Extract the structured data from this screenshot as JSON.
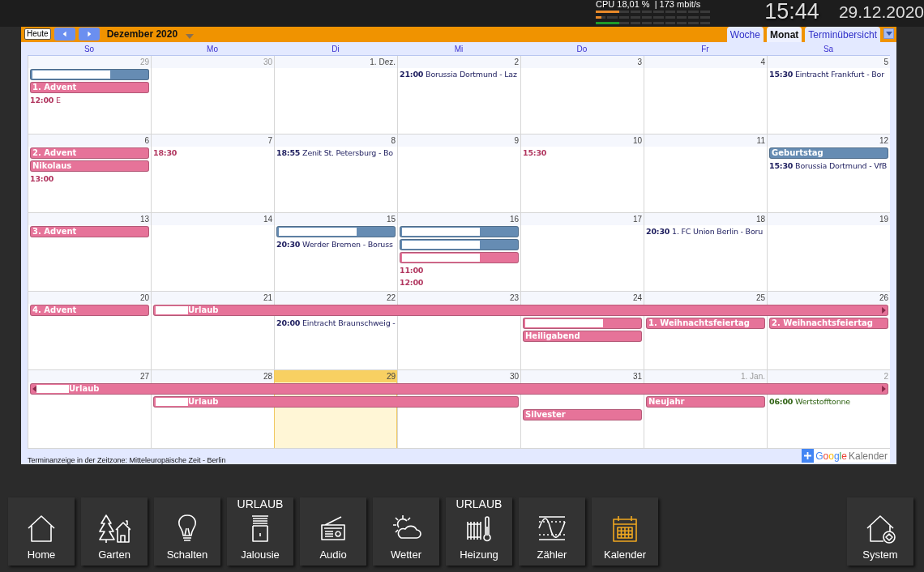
{
  "status": {
    "cpu": "CPU 18,01 %",
    "network": "| 173 mbit/s",
    "meters": [
      {
        "color": "#e8892a",
        "level": 0.2
      },
      {
        "color": "#e8892a",
        "level": 0.05
      },
      {
        "color": "#1f9a2a",
        "level": 0.2
      }
    ],
    "time": "15:44",
    "date": "29.12.2020"
  },
  "calendar": {
    "today_button": "Heute",
    "month": "Dezember 2020",
    "tabs": [
      {
        "label": "Woche",
        "selected": false
      },
      {
        "label": "Monat",
        "selected": true
      },
      {
        "label": "Terminübersicht",
        "selected": false
      }
    ],
    "weekdays": [
      "So",
      "Mo",
      "Di",
      "Mi",
      "Do",
      "Fr",
      "Sa"
    ],
    "weeks": [
      {
        "days": [
          {
            "label": "29",
            "other_month": true,
            "today": false
          },
          {
            "label": "30",
            "other_month": true,
            "today": false
          },
          {
            "label": "1. Dez.",
            "other_month": false,
            "today": false
          },
          {
            "label": "2",
            "other_month": false,
            "today": false
          },
          {
            "label": "3",
            "other_month": false,
            "today": false
          },
          {
            "label": "4",
            "other_month": false,
            "today": false
          },
          {
            "label": "5",
            "other_month": false,
            "today": false
          }
        ],
        "lanes": [
          [
            {
              "kind": "allday",
              "color": "#668cb3",
              "redacted": true
            },
            {
              "kind": "empty"
            },
            {
              "kind": "empty"
            },
            {
              "kind": "timed",
              "color": "#1d1d5e",
              "time": "21:00",
              "title": "Borussia Dortmund - Laz"
            },
            {
              "kind": "empty"
            },
            {
              "kind": "empty"
            },
            {
              "kind": "timed",
              "color": "#1d1d5e",
              "time": "15:30",
              "title": "Eintracht Frankfurt - Bor"
            }
          ],
          [
            {
              "kind": "allday",
              "color": "#e67399",
              "title": "1. Advent"
            }
          ],
          [
            {
              "kind": "timed",
              "color": "#b1365f",
              "time": "12:00",
              "title": "E"
            }
          ]
        ]
      },
      {
        "days": [
          {
            "label": "6",
            "other_month": false,
            "today": false
          },
          {
            "label": "7",
            "other_month": false,
            "today": false
          },
          {
            "label": "8",
            "other_month": false,
            "today": false
          },
          {
            "label": "9",
            "other_month": false,
            "today": false
          },
          {
            "label": "10",
            "other_month": false,
            "today": false
          },
          {
            "label": "11",
            "other_month": false,
            "today": false
          },
          {
            "label": "12",
            "other_month": false,
            "today": false
          }
        ],
        "lanes": [
          [
            {
              "kind": "allday",
              "color": "#e67399",
              "title": "2. Advent"
            },
            {
              "kind": "timed",
              "color": "#b1365f",
              "time": "18:30"
            },
            {
              "kind": "timed",
              "color": "#1d1d5e",
              "time": "18:55",
              "title": "Zenit St. Petersburg - Bo"
            },
            {
              "kind": "empty"
            },
            {
              "kind": "timed",
              "color": "#b1365f",
              "time": "15:30"
            },
            {
              "kind": "empty"
            },
            {
              "kind": "allday",
              "color": "#668cb3",
              "title": "Geburtstag"
            }
          ],
          [
            {
              "kind": "allday",
              "color": "#e67399",
              "title": "Nikolaus"
            },
            {
              "kind": "empty"
            },
            {
              "kind": "empty"
            },
            {
              "kind": "empty"
            },
            {
              "kind": "empty"
            },
            {
              "kind": "empty"
            },
            {
              "kind": "timed",
              "color": "#1d1d5e",
              "time": "15:30",
              "title": "Borussia Dortmund - VfB"
            }
          ],
          [
            {
              "kind": "timed",
              "color": "#b1365f",
              "time": "13:00"
            }
          ]
        ]
      },
      {
        "days": [
          {
            "label": "13",
            "other_month": false,
            "today": false
          },
          {
            "label": "14",
            "other_month": false,
            "today": false
          },
          {
            "label": "15",
            "other_month": false,
            "today": false
          },
          {
            "label": "16",
            "other_month": false,
            "today": false
          },
          {
            "label": "17",
            "other_month": false,
            "today": false
          },
          {
            "label": "18",
            "other_month": false,
            "today": false
          },
          {
            "label": "19",
            "other_month": false,
            "today": false
          }
        ],
        "lanes": [
          [
            {
              "kind": "allday",
              "color": "#e67399",
              "title": "3. Advent"
            },
            {
              "kind": "empty"
            },
            {
              "kind": "allday",
              "color": "#668cb3",
              "redacted": true
            },
            {
              "kind": "allday",
              "color": "#668cb3",
              "redacted": true
            },
            {
              "kind": "empty"
            },
            {
              "kind": "timed",
              "color": "#1d1d5e",
              "time": "20:30",
              "title": "1. FC Union Berlin - Boru"
            }
          ],
          [
            {
              "kind": "empty"
            },
            {
              "kind": "empty"
            },
            {
              "kind": "timed",
              "color": "#1d1d5e",
              "time": "20:30",
              "title": "Werder Bremen - Boruss"
            },
            {
              "kind": "allday",
              "color": "#668cb3",
              "redacted": true
            }
          ],
          [
            {
              "kind": "empty"
            },
            {
              "kind": "empty"
            },
            {
              "kind": "empty"
            },
            {
              "kind": "allday",
              "color": "#e67399",
              "redacted": true
            }
          ],
          [
            {
              "kind": "empty"
            },
            {
              "kind": "empty"
            },
            {
              "kind": "empty"
            },
            {
              "kind": "timed",
              "color": "#b1365f",
              "time": "11:00"
            }
          ],
          [
            {
              "kind": "empty"
            },
            {
              "kind": "empty"
            },
            {
              "kind": "empty"
            },
            {
              "kind": "timed",
              "color": "#b1365f",
              "time": "12:00"
            }
          ]
        ]
      },
      {
        "days": [
          {
            "label": "20",
            "other_month": false,
            "today": false
          },
          {
            "label": "21",
            "other_month": false,
            "today": false
          },
          {
            "label": "22",
            "other_month": false,
            "today": false
          },
          {
            "label": "23",
            "other_month": false,
            "today": false
          },
          {
            "label": "24",
            "other_month": false,
            "today": false
          },
          {
            "label": "25",
            "other_month": false,
            "today": false
          },
          {
            "label": "26",
            "other_month": false,
            "today": false
          }
        ],
        "lanes": [
          [
            {
              "kind": "allday",
              "color": "#e67399",
              "title": "4. Advent"
            },
            {
              "kind": "allday",
              "color": "#e67399",
              "redacted": true,
              "title": "Urlaub",
              "continues_after": true
            },
            {
              "kind": "cont"
            },
            {
              "kind": "cont"
            },
            {
              "kind": "cont"
            },
            {
              "kind": "cont"
            },
            {
              "kind": "cont"
            }
          ],
          [
            {
              "kind": "empty"
            },
            {
              "kind": "empty"
            },
            {
              "kind": "timed",
              "color": "#1d1d5e",
              "time": "20:00",
              "title": "Eintracht Braunschweig -"
            },
            {
              "kind": "empty"
            },
            {
              "kind": "allday",
              "color": "#e67399",
              "redacted": true
            },
            {
              "kind": "allday",
              "color": "#e67399",
              "title": "1. Weihnachtsfeiertag"
            },
            {
              "kind": "allday",
              "color": "#e67399",
              "title": "2. Weihnachtsfeiertag"
            }
          ],
          [
            {
              "kind": "empty"
            },
            {
              "kind": "empty"
            },
            {
              "kind": "empty"
            },
            {
              "kind": "empty"
            },
            {
              "kind": "allday",
              "color": "#e67399",
              "title": "Heiligabend"
            }
          ]
        ]
      },
      {
        "days": [
          {
            "label": "27",
            "other_month": false,
            "today": false
          },
          {
            "label": "28",
            "other_month": false,
            "today": false
          },
          {
            "label": "29",
            "other_month": false,
            "today": true
          },
          {
            "label": "30",
            "other_month": false,
            "today": false
          },
          {
            "label": "31",
            "other_month": false,
            "today": false
          },
          {
            "label": "1. Jan.",
            "other_month": true,
            "today": false
          },
          {
            "label": "2",
            "other_month": true,
            "today": false
          }
        ],
        "lanes": [
          [
            {
              "kind": "allday",
              "color": "#e67399",
              "redacted": true,
              "title": "Urlaub",
              "continues_before": true,
              "continues_after": true
            },
            {
              "kind": "cont"
            },
            {
              "kind": "cont"
            },
            {
              "kind": "cont"
            },
            {
              "kind": "cont"
            },
            {
              "kind": "cont"
            },
            {
              "kind": "cont"
            }
          ],
          [
            {
              "kind": "empty"
            },
            {
              "kind": "allday",
              "color": "#e67399",
              "redacted": true,
              "title": "Urlaub"
            },
            {
              "kind": "cont"
            },
            {
              "kind": "cont"
            },
            {
              "kind": "empty"
            },
            {
              "kind": "allday",
              "color": "#e67399",
              "title": "Neujahr"
            },
            {
              "kind": "timed",
              "color": "#2f6213",
              "time": "06:00",
              "title": "Wertstofftonne"
            }
          ],
          [
            {
              "kind": "empty"
            },
            {
              "kind": "empty"
            },
            {
              "kind": "empty"
            },
            {
              "kind": "empty"
            },
            {
              "kind": "allday",
              "color": "#e67399",
              "title": "Silvester"
            }
          ]
        ]
      }
    ],
    "timezone_note": "Terminanzeige in der Zeitzone: Mitteleuropäische Zeit - Berlin",
    "google_button": {
      "brand": "Google",
      "label": "Kalender"
    }
  },
  "nav": {
    "left": [
      {
        "label": "Home",
        "kind": "home",
        "selected": false
      },
      {
        "label": "Garten",
        "kind": "garden",
        "selected": false
      },
      {
        "label": "Schalten",
        "kind": "bulb",
        "selected": false
      },
      {
        "label": "Jalousie",
        "kind": "blind",
        "selected": false,
        "badge": "URLAUB"
      },
      {
        "label": "Audio",
        "kind": "radio",
        "selected": false
      },
      {
        "label": "Wetter",
        "kind": "weather",
        "selected": false
      },
      {
        "label": "Heizung",
        "kind": "radiator",
        "selected": false,
        "badge": "URLAUB"
      },
      {
        "label": "Zähler",
        "kind": "meter",
        "selected": false
      },
      {
        "label": "Kalender",
        "kind": "calendar",
        "selected": true
      }
    ],
    "right": [
      {
        "label": "System",
        "kind": "system",
        "selected": false
      }
    ]
  }
}
